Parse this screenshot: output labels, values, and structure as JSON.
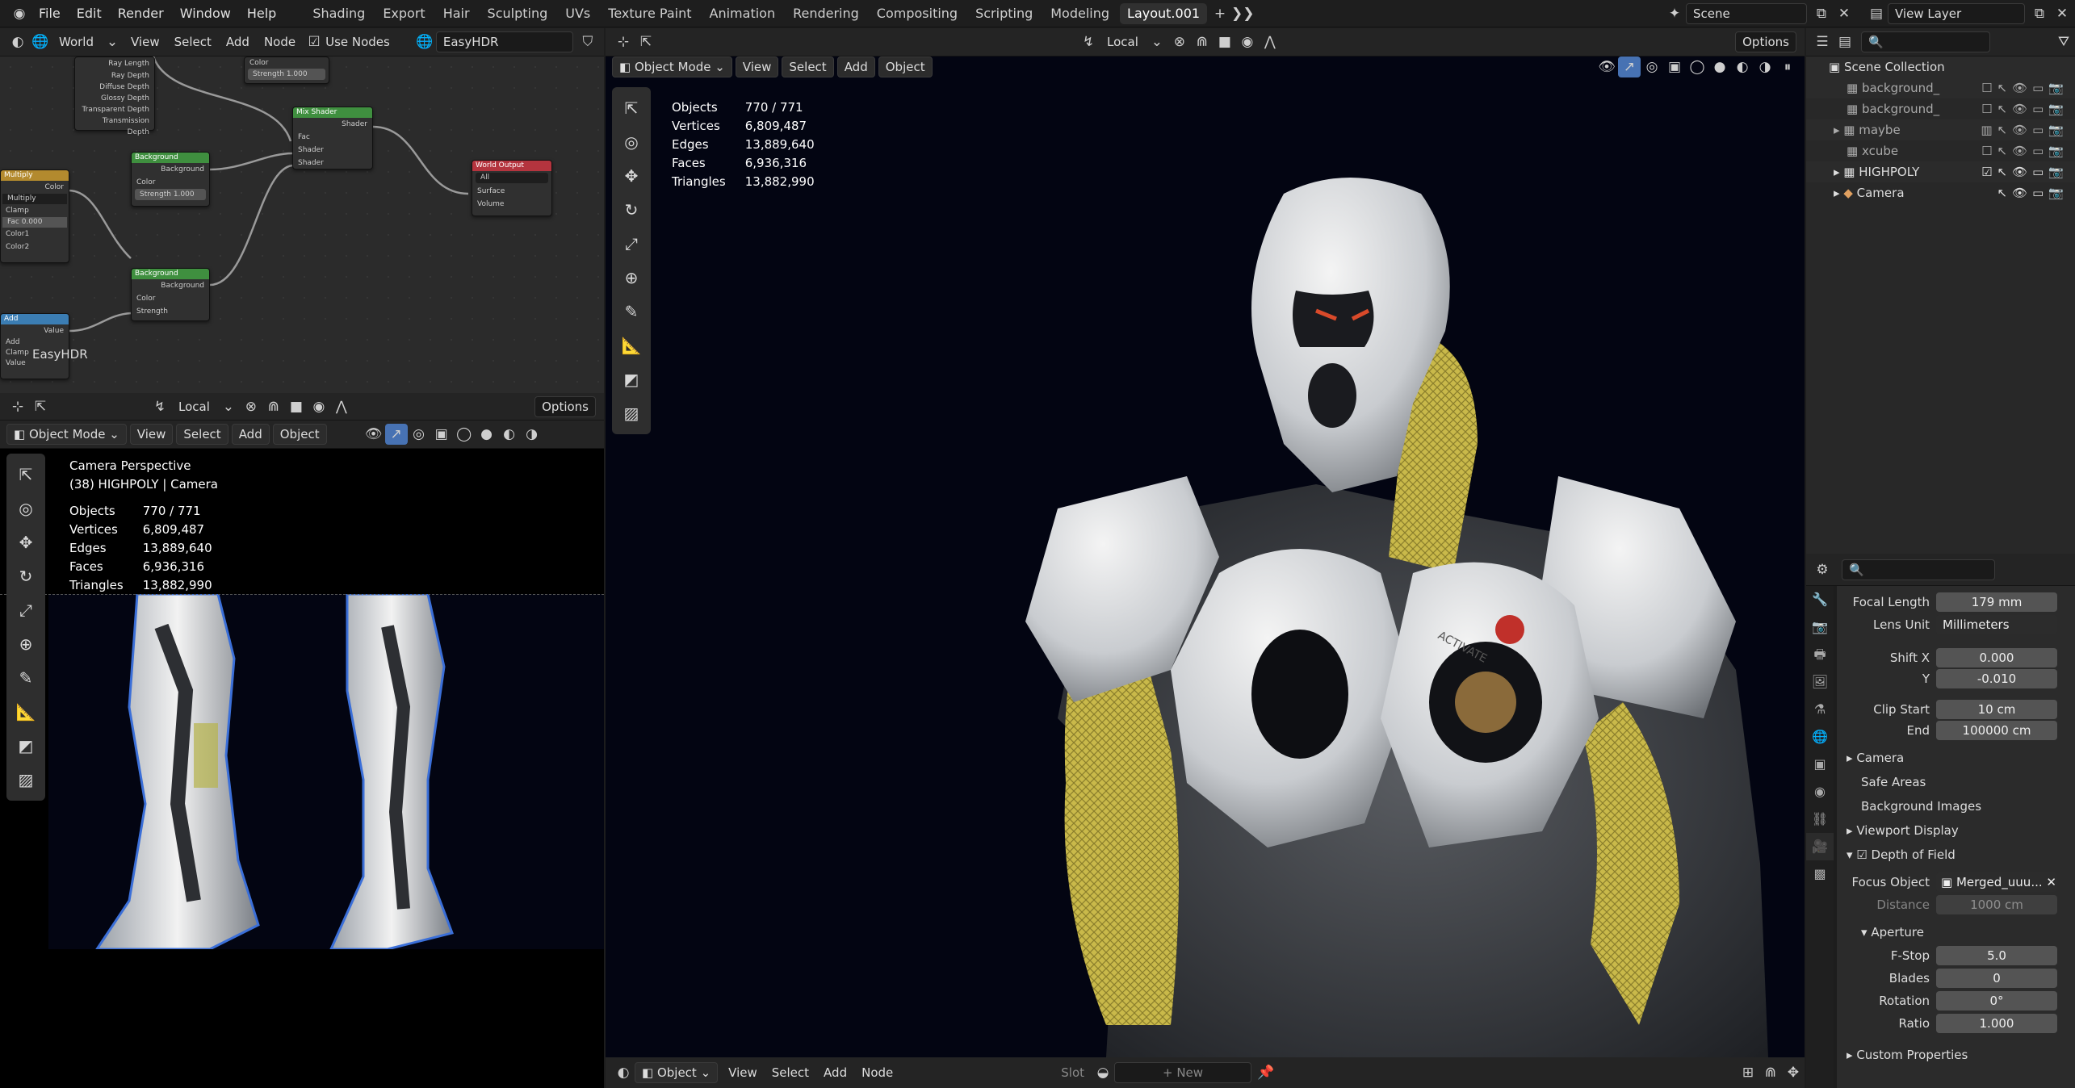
{
  "topbar": {
    "menus": [
      "File",
      "Edit",
      "Render",
      "Window",
      "Help"
    ],
    "workspaces": [
      "Shading",
      "Export",
      "Hair",
      "Sculpting",
      "UVs",
      "Texture Paint",
      "Animation",
      "Rendering",
      "Compositing",
      "Scripting",
      "Modeling",
      "Layout.001"
    ],
    "active_workspace": "Layout.001",
    "scene_label": "Scene",
    "view_layer_label": "View Layer"
  },
  "node_editor": {
    "world_label": "World",
    "menus": [
      "View",
      "Select",
      "Add",
      "Node"
    ],
    "use_nodes_label": "Use Nodes",
    "world_name": "EasyHDR",
    "watermark": "EasyHDR",
    "nodes": {
      "light_path_outputs": [
        "Ray Length",
        "Ray Depth",
        "Diffuse Depth",
        "Glossy Depth",
        "Transparent Depth",
        "Transmission Depth"
      ],
      "bg_top": {
        "color_label": "Color",
        "strength_label": "Strength",
        "strength_value": "1.000"
      },
      "bg1": {
        "title": "Background",
        "out": "Background",
        "color": "Color",
        "strength_label": "Strength",
        "strength_value": "1.000"
      },
      "bg2": {
        "title": "Background",
        "out": "Background",
        "color": "Color",
        "strength": "Strength"
      },
      "mix": {
        "title": "Mix Shader",
        "out": "Shader",
        "fac": "Fac",
        "s1": "Shader",
        "s2": "Shader"
      },
      "output": {
        "title": "World Output",
        "target": "All",
        "surface": "Surface",
        "volume": "Volume"
      },
      "multiply": {
        "title": "Multiply",
        "out": "Color",
        "mode": "Multiply",
        "clamp": "Clamp",
        "fac_label": "Fac",
        "fac_value": "0.000",
        "c1": "Color1",
        "c2": "Color2"
      },
      "add": {
        "title": "Add",
        "out": "Value",
        "mode": "Add",
        "clamp": "Clamp",
        "value": "Value"
      }
    }
  },
  "mid_header": {
    "transform": "Local",
    "options": "Options"
  },
  "left_viewport": {
    "mode": "Object Mode",
    "menus": [
      "View",
      "Select",
      "Add",
      "Object"
    ],
    "title": "Camera Perspective",
    "subtitle": "(38) HIGHPOLY | Camera",
    "stats": [
      {
        "label": "Objects",
        "value": "770 / 771"
      },
      {
        "label": "Vertices",
        "value": "6,809,487"
      },
      {
        "label": "Edges",
        "value": "13,889,640"
      },
      {
        "label": "Faces",
        "value": "6,936,316"
      },
      {
        "label": "Triangles",
        "value": "13,882,990"
      }
    ]
  },
  "main_viewport": {
    "transform": "Local",
    "options": "Options",
    "mode": "Object Mode",
    "menus": [
      "View",
      "Select",
      "Add",
      "Object"
    ],
    "stats": [
      {
        "label": "Objects",
        "value": "770 / 771"
      },
      {
        "label": "Vertices",
        "value": "6,809,487"
      },
      {
        "label": "Edges",
        "value": "13,889,640"
      },
      {
        "label": "Faces",
        "value": "6,936,316"
      },
      {
        "label": "Triangles",
        "value": "13,882,990"
      }
    ],
    "decal_text": "ACTIVATE"
  },
  "bottom_bar": {
    "mode": "Object",
    "menus": [
      "View",
      "Select",
      "Add",
      "Node"
    ],
    "slot": "Slot",
    "new": "New"
  },
  "outliner": {
    "root": "Scene Collection",
    "items": [
      {
        "name": "background_"
      },
      {
        "name": "background_"
      },
      {
        "name": "maybe"
      },
      {
        "name": "xcube"
      },
      {
        "name": "HIGHPOLY"
      },
      {
        "name": "Camera"
      }
    ]
  },
  "properties": {
    "focal_length_label": "Focal Length",
    "focal_length": "179 mm",
    "lens_unit_label": "Lens Unit",
    "lens_unit": "Millimeters",
    "shift_x_label": "Shift X",
    "shift_x": "0.000",
    "shift_y_label": "Y",
    "shift_y": "-0.010",
    "clip_start_label": "Clip Start",
    "clip_start": "10 cm",
    "clip_end_label": "End",
    "clip_end": "100000 cm",
    "sections": [
      "Camera",
      "Safe Areas",
      "Background Images",
      "Viewport Display"
    ],
    "dof_label": "Depth of Field",
    "focus_object_label": "Focus Object",
    "focus_object": "Merged_uuu...",
    "distance_label": "Distance",
    "distance": "1000 cm",
    "aperture_label": "Aperture",
    "fstop_label": "F-Stop",
    "fstop": "5.0",
    "blades_label": "Blades",
    "blades": "0",
    "rotation_label": "Rotation",
    "rotation": "0°",
    "ratio_label": "Ratio",
    "ratio": "1.000",
    "custom_props_label": "Custom Properties"
  }
}
